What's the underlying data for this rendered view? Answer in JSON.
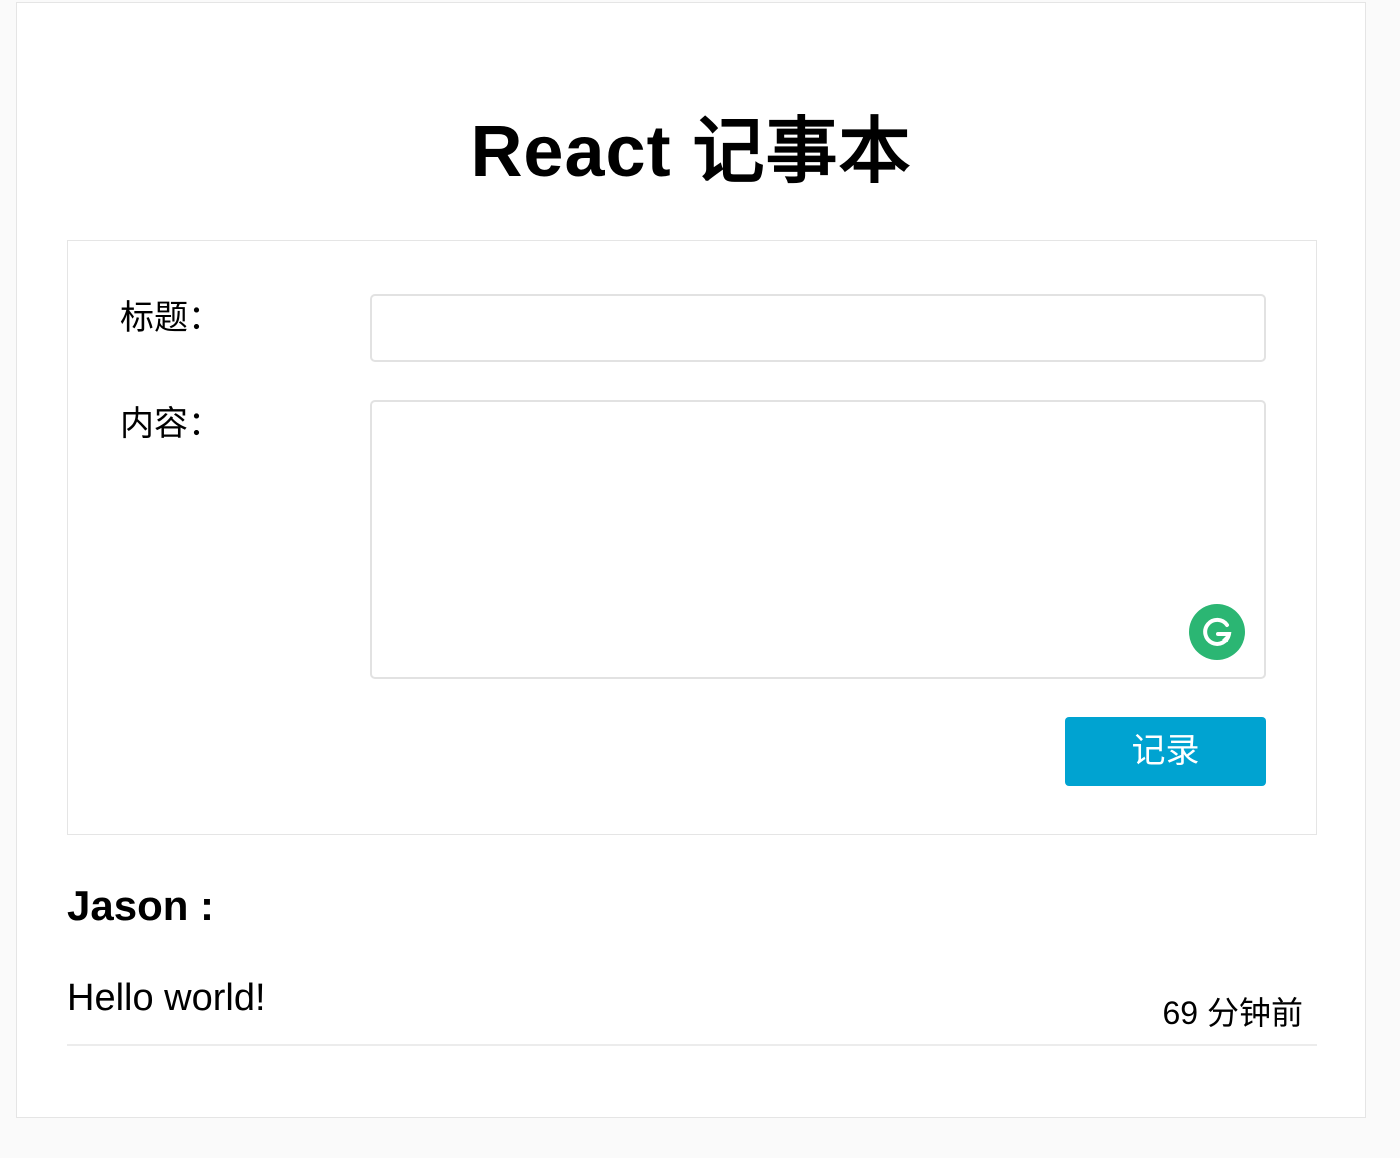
{
  "header": {
    "title": "React 记事本"
  },
  "form": {
    "title_label": "标题：",
    "title_value": "",
    "content_label": "内容：",
    "content_value": "",
    "submit_label": "记录"
  },
  "colors": {
    "accent": "#00a3d1",
    "grammarly": "#2bb673"
  },
  "notes": [
    {
      "author": "Jason :",
      "body": "Hello world!",
      "time": "69 分钟前"
    }
  ],
  "icons": {
    "textarea_badge": "grammarly-icon"
  }
}
